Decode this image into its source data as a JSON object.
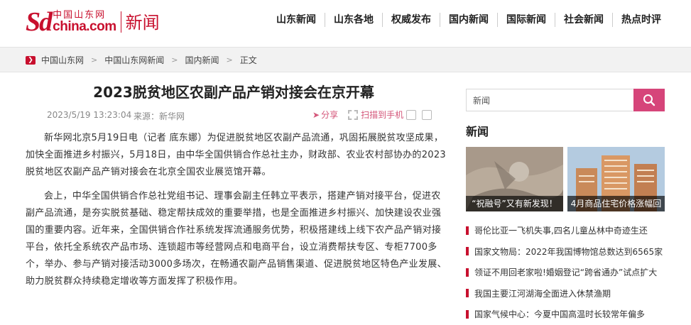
{
  "header": {
    "logo_sd": "Sd",
    "logo_cn": "中国山东网",
    "logo_com": "china.com",
    "logo_news": "新闻",
    "nav": [
      "山东新闻",
      "山东各地",
      "权威发布",
      "国内新闻",
      "国际新闻",
      "社会新闻",
      "热点时评"
    ]
  },
  "breadcrumb": {
    "items": [
      "中国山东网",
      "中国山东网新闻",
      "国内新闻",
      "正文"
    ],
    "separator": ">"
  },
  "article": {
    "title": "2023脱贫地区农副产品产销对接会在京开幕",
    "date": "2023/5/19 13:23:04",
    "source": "来源：新华网",
    "share_label": "分享",
    "scan_label": "扫描到手机",
    "paragraphs": [
      "新华网北京5月19日电（记者 底东娜）为促进脱贫地区农副产品流通，巩固拓展脱贫攻坚成果，加快全面推进乡村振兴，5月18日，由中华全国供销合作总社主办，财政部、农业农村部协办的2023脱贫地区农副产品产销对接会在北京全国农业展览馆开幕。",
      "会上，中华全国供销合作总社党组书记、理事会副主任韩立平表示，搭建产销对接平台，促进农副产品流通，是夯实脱贫基础、稳定帮扶成效的重要举措，也是全面推进乡村振兴、加快建设农业强国的重要内容。近年来，全国供销合作社系统发挥流通服务优势，积极搭建线上线下农产品产销对接平台，依托全系统农产品市场、连锁超市等经营网点和电商平台，设立消费帮扶专区、专柜7700多个，举办、参与产销对接活动3000多场次，在畅通农副产品销售渠道、促进脱贫地区特色产业发展、助力脱贫群众持续稳定增收等方面发挥了积极作用。"
    ]
  },
  "sidebar": {
    "search_placeholder": "新闻",
    "heading": "新闻",
    "thumbs": [
      {
        "caption": "“祝融号”又有新发现！"
      },
      {
        "caption": "4月商品住宅价格涨幅回"
      }
    ],
    "news": [
      "哥伦比亚一飞机失事,四名儿童丛林中奇迹生还",
      "国家文物局：2022年我国博物馆总数达到6565家",
      "领证不用回老家啦!婚姻登记“跨省通办”试点扩大",
      "我国主要江河湖海全面进入休禁渔期",
      "国家气候中心：今夏中国高温时长较常年偏多"
    ]
  },
  "colors": {
    "brand_red": "#c8102e",
    "search_button": "#d6457a"
  }
}
